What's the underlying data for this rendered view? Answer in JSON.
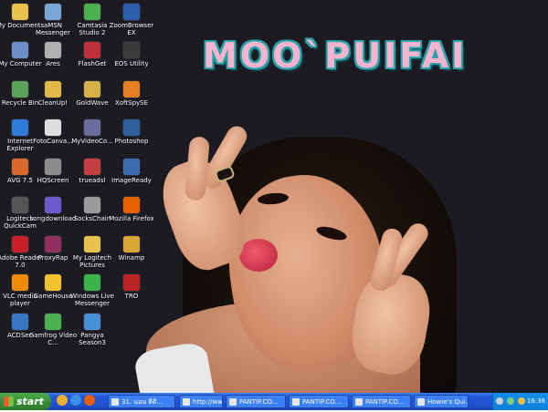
{
  "wallpaper": {
    "title": "MOO`PUIFAI"
  },
  "desktop_icons": [
    {
      "label": "My Documents",
      "icon": "folder-icon",
      "color": "#e9c24e"
    },
    {
      "label": "aMSN Messenger",
      "icon": "chat-icon",
      "color": "#7aa6d6"
    },
    {
      "label": "Camtasia Studio 2",
      "icon": "camtasia-icon",
      "color": "#4caf50"
    },
    {
      "label": "ZoomBrowser EX",
      "icon": "camera-icon",
      "color": "#2b5fae"
    },
    {
      "label": "My Computer",
      "icon": "computer-icon",
      "color": "#6d8fc9"
    },
    {
      "label": "Ares",
      "icon": "ares-icon",
      "color": "#b0b0b0"
    },
    {
      "label": "FlashGet",
      "icon": "download-icon",
      "color": "#c0303a"
    },
    {
      "label": "EOS Utility",
      "icon": "camera-icon",
      "color": "#3a3a3a"
    },
    {
      "label": "Recycle Bin",
      "icon": "recycle-bin-icon",
      "color": "#5aa15a"
    },
    {
      "label": "CleanUp!",
      "icon": "cleanup-icon",
      "color": "#e2b84a"
    },
    {
      "label": "GoldWave",
      "icon": "audio-icon",
      "color": "#d4b04a"
    },
    {
      "label": "XoftSpySE",
      "icon": "shield-icon",
      "color": "#e67e22"
    },
    {
      "label": "Internet Explorer",
      "icon": "browser-icon",
      "color": "#2c7dd8"
    },
    {
      "label": "FotoCanva...",
      "icon": "photo-icon",
      "color": "#dddddd"
    },
    {
      "label": "MyVideoCo...",
      "icon": "video-icon",
      "color": "#6b6b9e"
    },
    {
      "label": "Photoshop",
      "icon": "photoshop-icon",
      "color": "#2f5f9e"
    },
    {
      "label": "AVG 7.5",
      "icon": "antivirus-icon",
      "color": "#d9682c"
    },
    {
      "label": "HQScreen",
      "icon": "screen-icon",
      "color": "#8c8c8c"
    },
    {
      "label": "trueadsl",
      "icon": "network-icon",
      "color": "#c44040"
    },
    {
      "label": "ImageReady",
      "icon": "imageready-icon",
      "color": "#3b6bb1"
    },
    {
      "label": "Logitech QuickCam",
      "icon": "webcam-icon",
      "color": "#555"
    },
    {
      "label": "songdownload",
      "icon": "music-icon",
      "color": "#6a5acd"
    },
    {
      "label": "SocksChain",
      "icon": "chain-icon",
      "color": "#9a9a9a"
    },
    {
      "label": "Mozilla Firefox",
      "icon": "firefox-icon",
      "color": "#e66000"
    },
    {
      "label": "Adobe Reader 7.0",
      "icon": "pdf-icon",
      "color": "#c8202a"
    },
    {
      "label": "ProxyRap",
      "icon": "proxy-icon",
      "color": "#8e2f5e"
    },
    {
      "label": "My Logitech Pictures",
      "icon": "folder-icon",
      "color": "#e9c24e"
    },
    {
      "label": "Winamp",
      "icon": "winamp-icon",
      "color": "#d9a633"
    },
    {
      "label": "VLC media player",
      "icon": "vlc-icon",
      "color": "#f08a00"
    },
    {
      "label": "GameHouse",
      "icon": "star-icon",
      "color": "#f2c230"
    },
    {
      "label": "Windows Live Messenger",
      "icon": "messenger-icon",
      "color": "#3bb34a"
    },
    {
      "label": "TRO",
      "icon": "game-icon",
      "color": "#b22"
    },
    {
      "label": "ACDSee",
      "icon": "viewer-icon",
      "color": "#3a75c4"
    },
    {
      "label": "Gamfrog Video C...",
      "icon": "frog-icon",
      "color": "#4caf50"
    },
    {
      "label": "Pangya Season3",
      "icon": "golf-icon",
      "color": "#4a90d9"
    }
  ],
  "taskbar": {
    "start_label": "start",
    "quick_launch": [
      "ie-icon",
      "media-icon",
      "firefox-icon"
    ],
    "tasks": [
      {
        "label": "31. นอน ดีดี...",
        "icon": "folder-icon"
      },
      {
        "label": "http://www....",
        "icon": "browser-icon"
      },
      {
        "label": "PANTIP.CO...",
        "icon": "browser-icon"
      },
      {
        "label": "PANTIP.CO...",
        "icon": "browser-icon"
      },
      {
        "label": "PANTIP.CO...",
        "icon": "browser-icon"
      },
      {
        "label": "Howie's Qui...",
        "icon": "window-icon"
      }
    ],
    "clock": "16:36"
  }
}
